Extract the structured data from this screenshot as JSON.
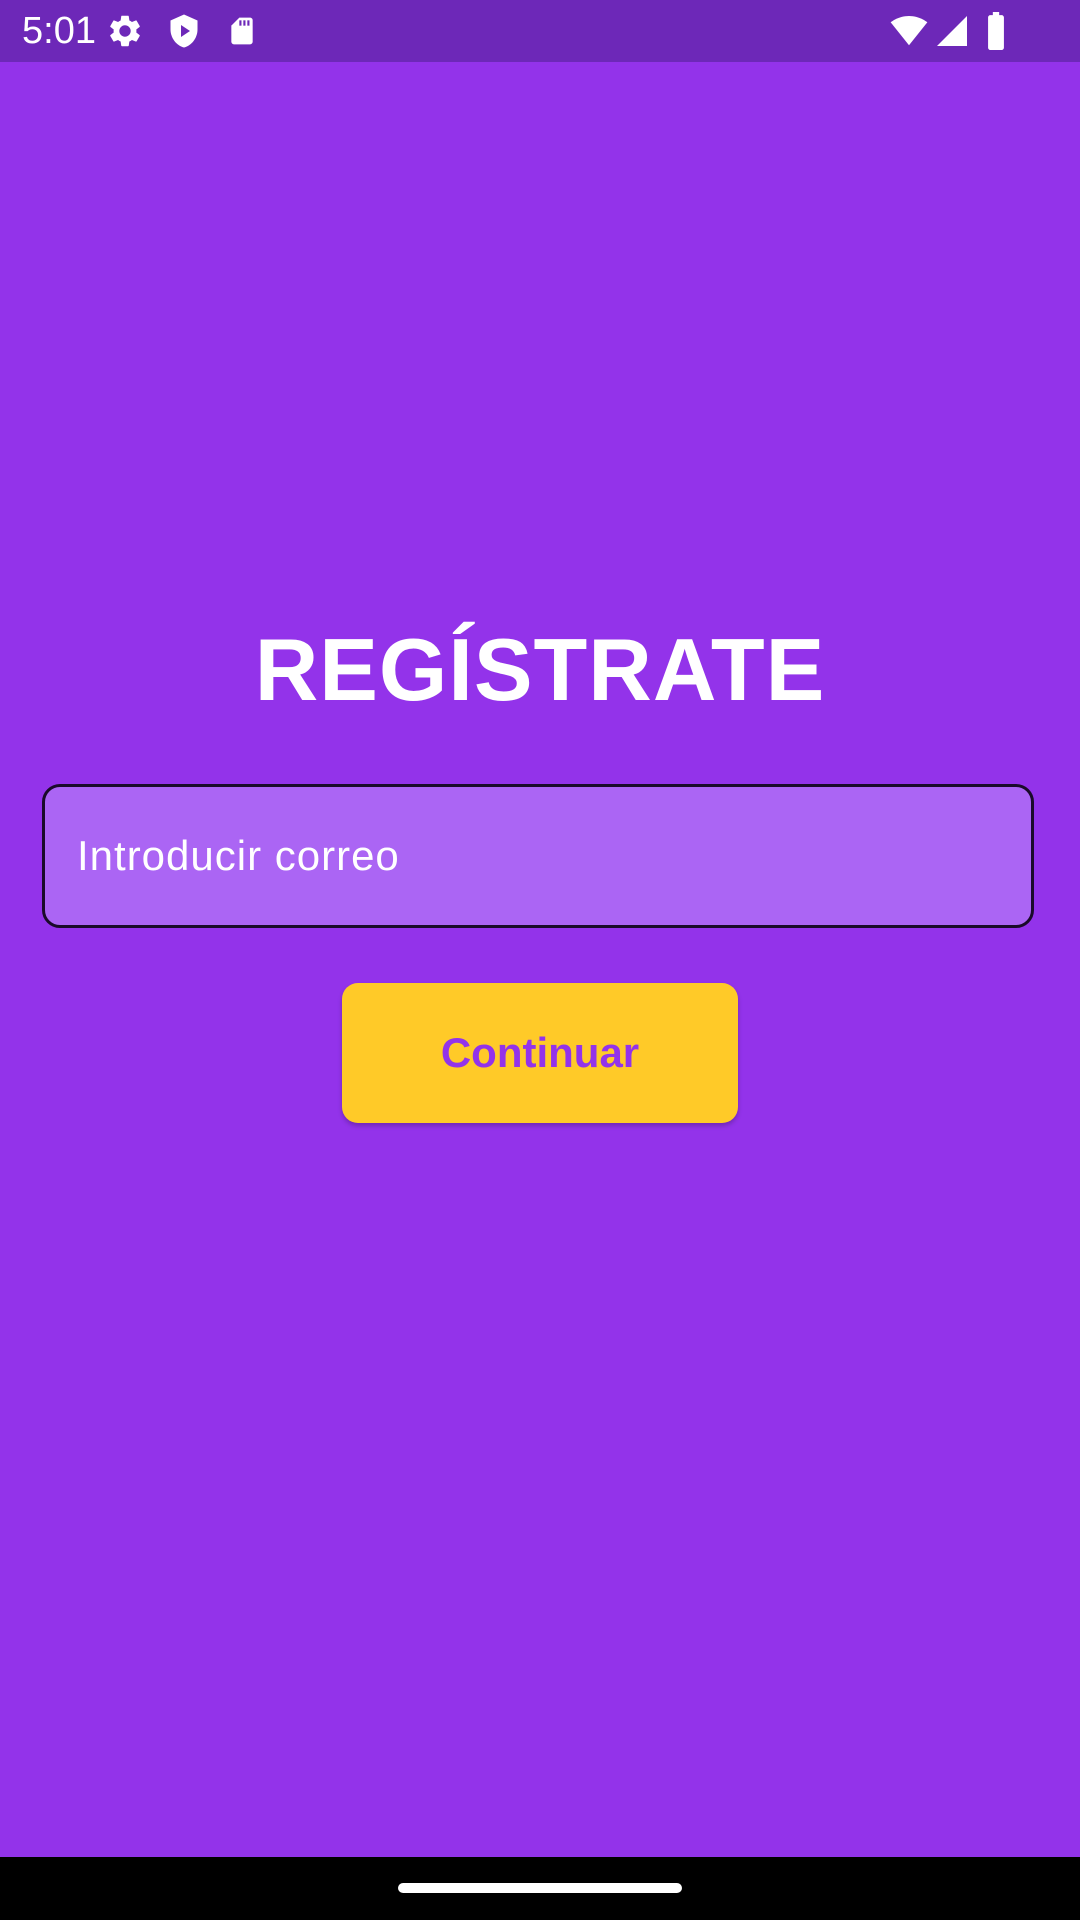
{
  "status_bar": {
    "time": "5:01",
    "left_icons": [
      "settings-icon",
      "shield-play-icon",
      "sd-card-icon"
    ],
    "right_icons": [
      "wifi-icon",
      "cell-signal-icon",
      "battery-icon"
    ]
  },
  "main": {
    "title": "REGÍSTRATE",
    "email_placeholder": "Introducir correo",
    "continue_label": "Continuar"
  },
  "colors": {
    "background": "#9333ea",
    "status_bar": "#6d28b8",
    "field_fill": "#ab65f4",
    "button_fill": "#ffca28",
    "button_text": "#9333ea"
  }
}
